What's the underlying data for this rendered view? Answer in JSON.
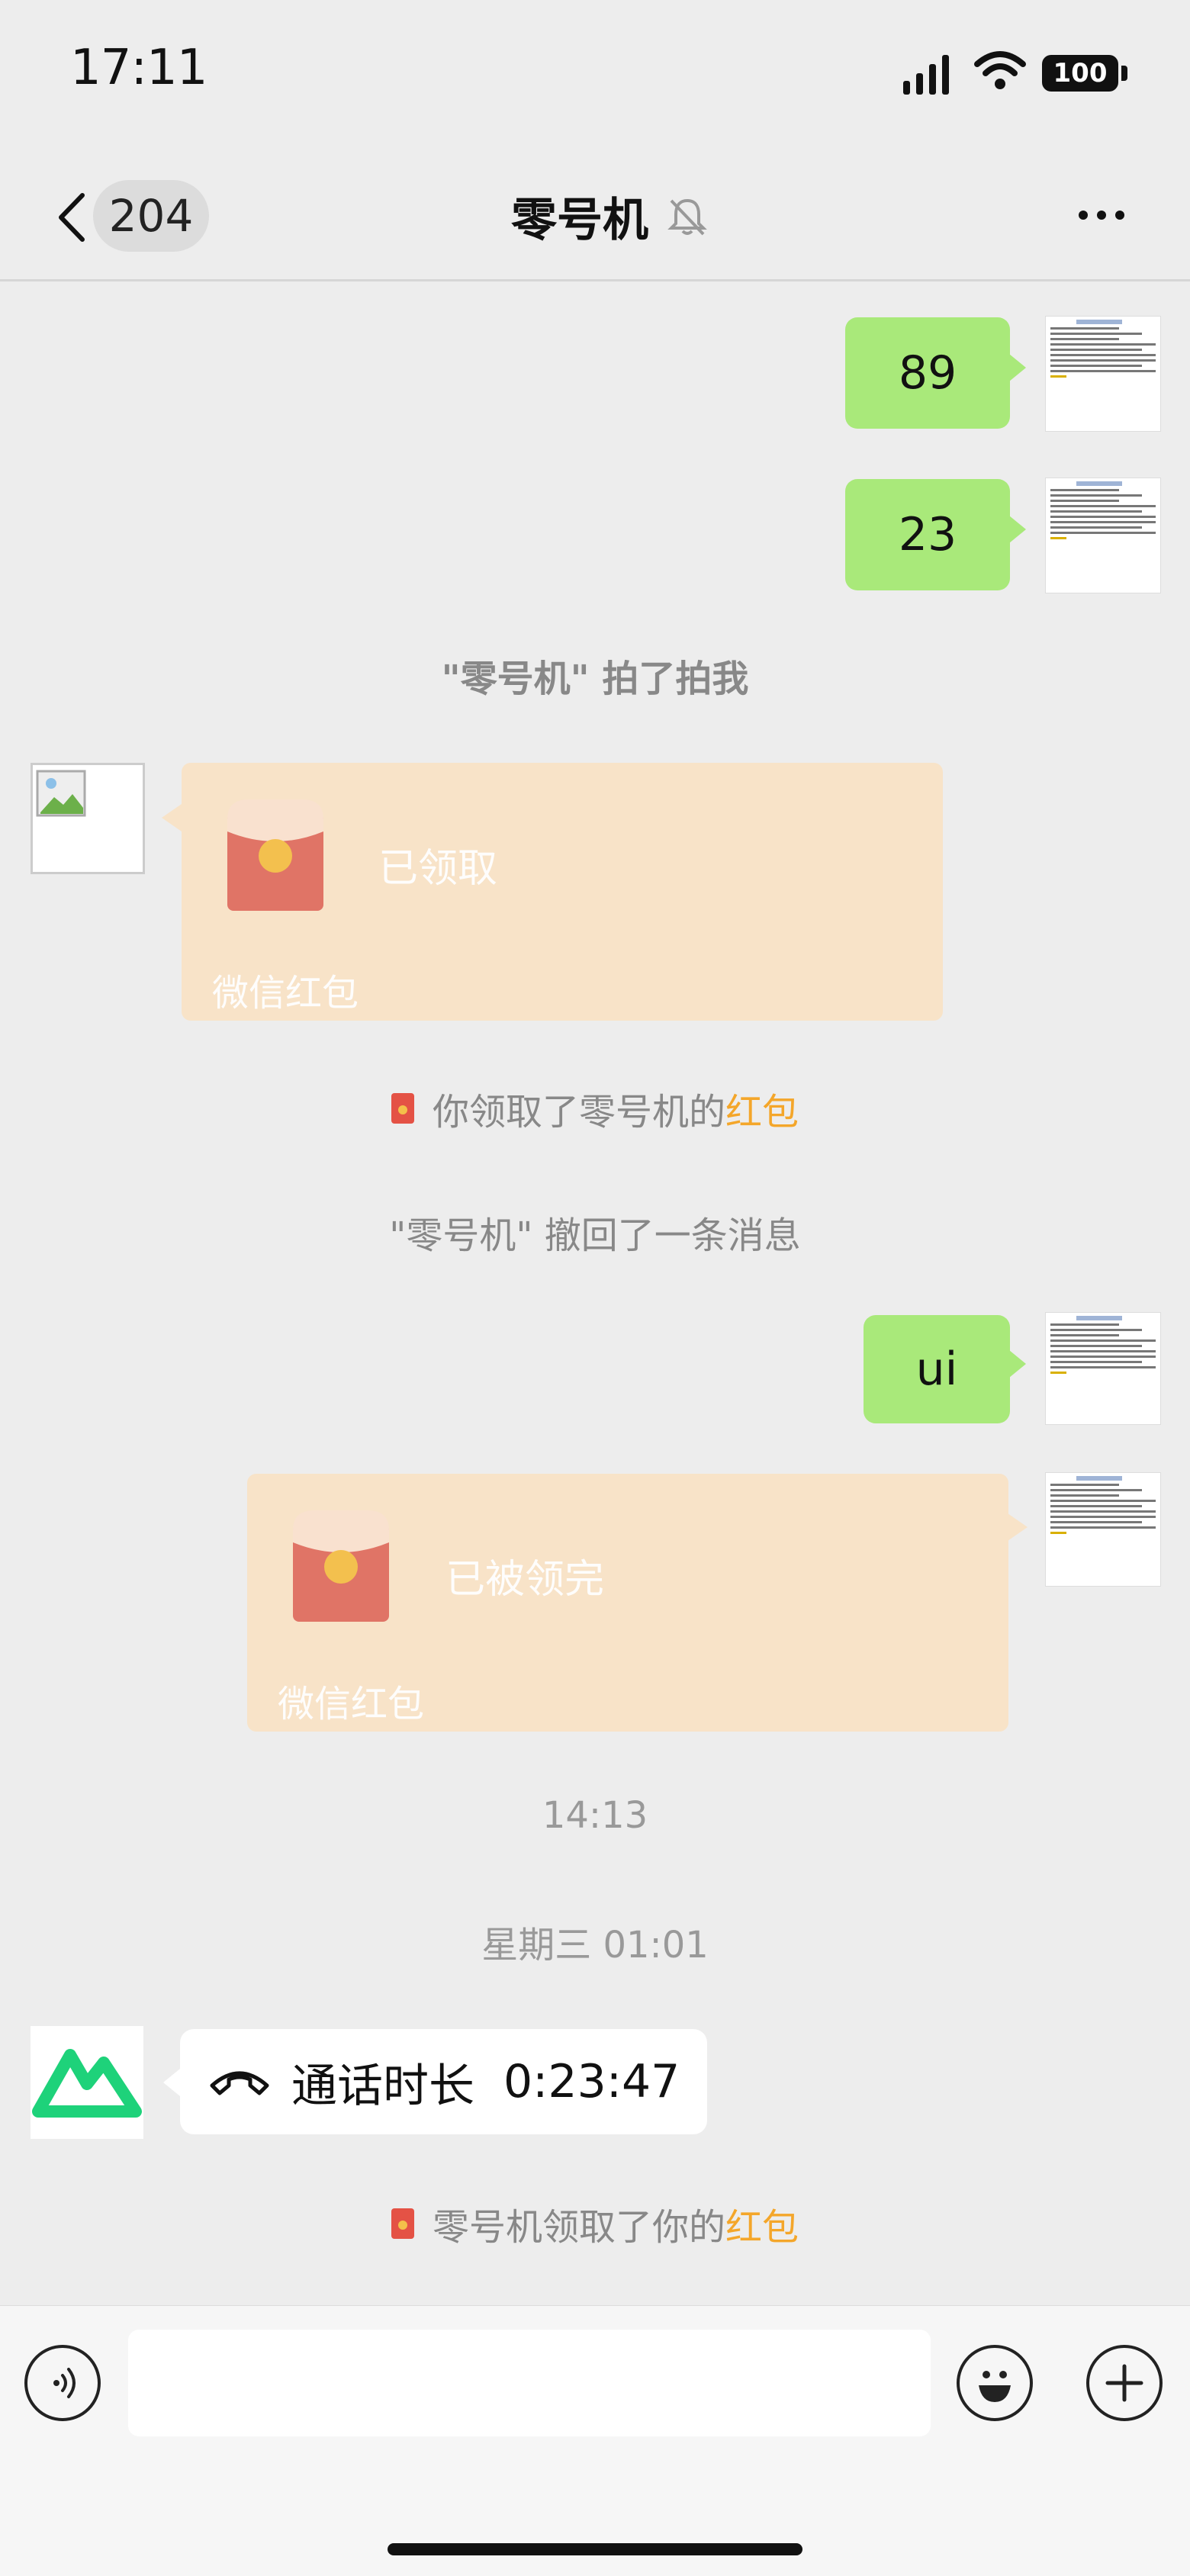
{
  "status_bar": {
    "time": "17:11",
    "battery": "100"
  },
  "nav": {
    "unread_count": "204",
    "title": "零号机"
  },
  "messages": {
    "m1": "89",
    "m2": "23",
    "pat": "\"零号机\" 拍了拍我",
    "envelope1": {
      "status": "已领取",
      "label": "微信红包"
    },
    "received_prefix": "你领取了零号机的",
    "received_hl": "红包",
    "recalled": "\"零号机\" 撤回了一条消息",
    "m3": "ui",
    "envelope2": {
      "status": "已被领完",
      "label": "微信红包"
    },
    "ts1": "14:13",
    "ts2": "星期三 01:01",
    "call": {
      "label": "通话时长",
      "duration": "0:23:47"
    },
    "claimed_prefix": "零号机领取了你的",
    "claimed_hl": "红包"
  },
  "input": {
    "placeholder": ""
  },
  "colors": {
    "bubble_green": "#A9E97A",
    "envelope_bg": "#F8E3C8",
    "highlight": "#F4A62A",
    "logo_green": "#1ED27A"
  },
  "icons": [
    "back-chevron-icon",
    "mute-bell-icon",
    "more-icon",
    "voice-icon",
    "emoji-icon",
    "plus-icon",
    "phone-icon",
    "red-envelope-icon"
  ]
}
